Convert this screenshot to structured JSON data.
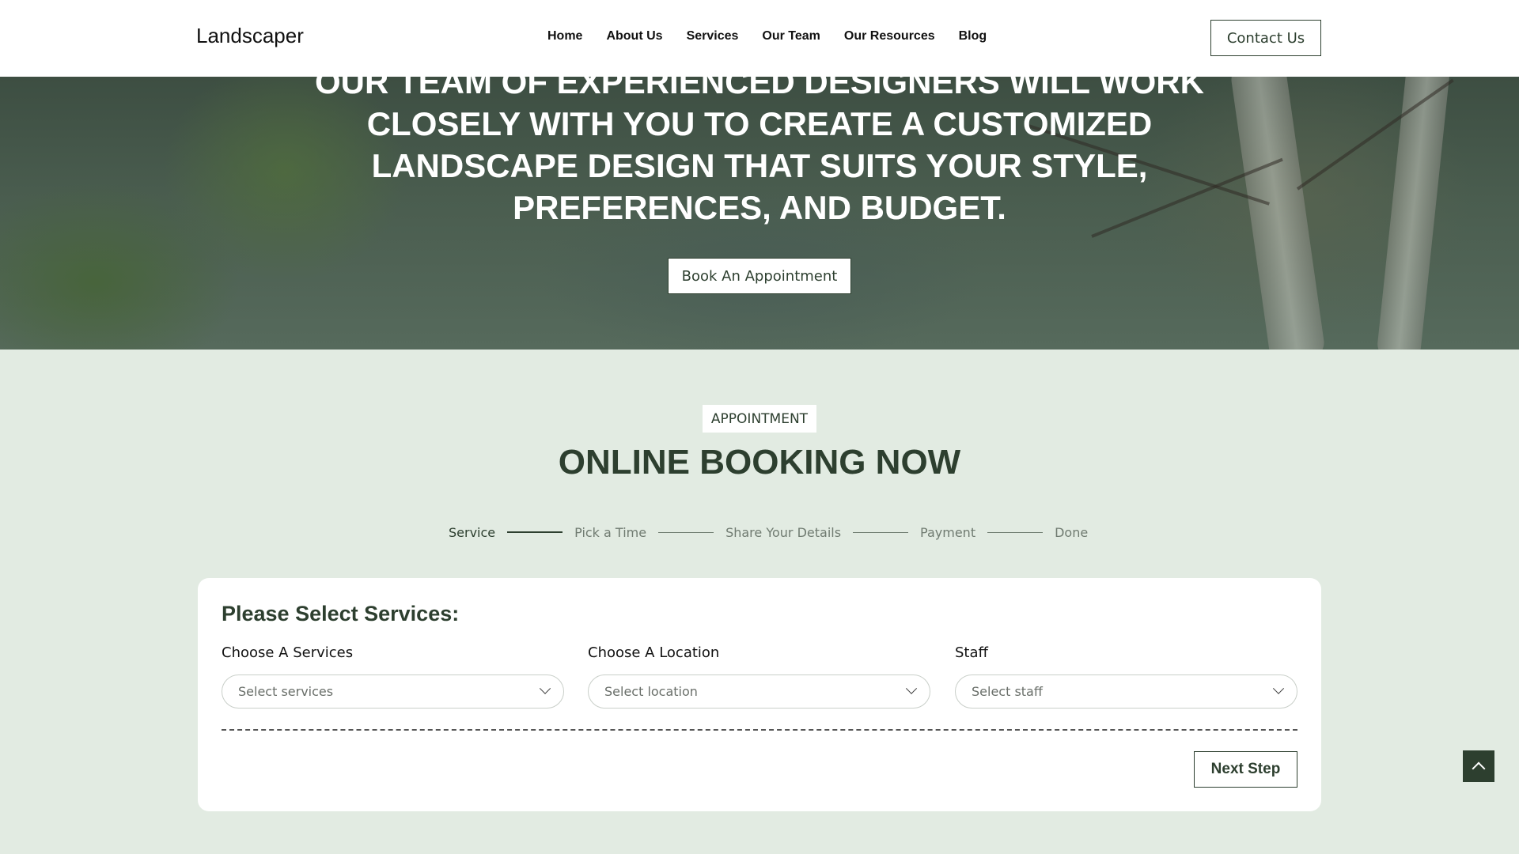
{
  "header": {
    "brand": "Landscaper",
    "nav": [
      "Home",
      "About Us",
      "Services",
      "Our Team",
      "Our Resources",
      "Blog"
    ],
    "contact_label": "Contact Us"
  },
  "hero": {
    "headline": "Our team of experienced designers will work closely with you to create a customized landscape design that suits your style, preferences, and budget.",
    "cta_label": "Book An Appointment"
  },
  "appointment": {
    "eyebrow": "APPOINTMENT",
    "title": "ONLINE BOOKING NOW",
    "steps": [
      "Service",
      "Pick a Time",
      "Share Your Details",
      "Payment",
      "Done"
    ],
    "active_step": "Service"
  },
  "form": {
    "title": "Please Select Services:",
    "fields": [
      {
        "label": "Choose A Services",
        "placeholder": "Select services"
      },
      {
        "label": "Choose A Location",
        "placeholder": "Select location"
      },
      {
        "label": "Staff",
        "placeholder": "Select staff"
      }
    ],
    "next_label": "Next Step"
  },
  "colors": {
    "accent": "#2d3f2f",
    "page_bg": "#e2ebe2"
  },
  "icons": {
    "back_to_top": "chevron-up-icon",
    "select_caret": "chevron-down-icon"
  }
}
